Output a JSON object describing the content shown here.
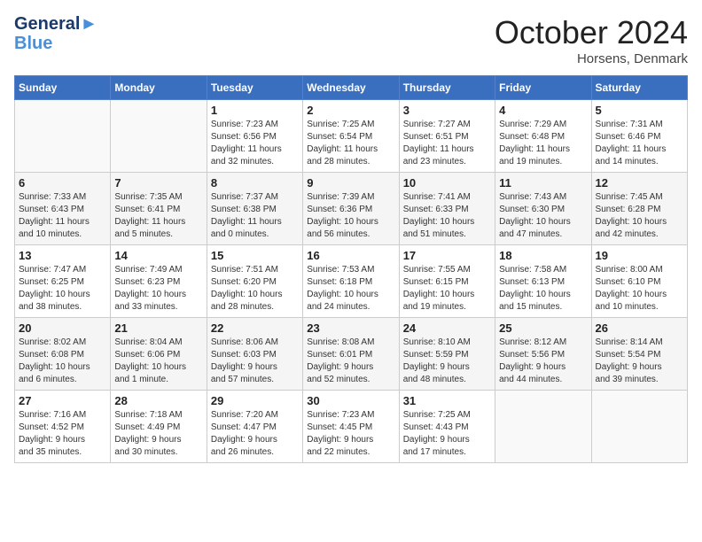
{
  "header": {
    "logo_line1": "General",
    "logo_line2": "Blue",
    "month": "October 2024",
    "location": "Horsens, Denmark"
  },
  "weekdays": [
    "Sunday",
    "Monday",
    "Tuesday",
    "Wednesday",
    "Thursday",
    "Friday",
    "Saturday"
  ],
  "weeks": [
    [
      {
        "day": "",
        "info": ""
      },
      {
        "day": "",
        "info": ""
      },
      {
        "day": "1",
        "info": "Sunrise: 7:23 AM\nSunset: 6:56 PM\nDaylight: 11 hours\nand 32 minutes."
      },
      {
        "day": "2",
        "info": "Sunrise: 7:25 AM\nSunset: 6:54 PM\nDaylight: 11 hours\nand 28 minutes."
      },
      {
        "day": "3",
        "info": "Sunrise: 7:27 AM\nSunset: 6:51 PM\nDaylight: 11 hours\nand 23 minutes."
      },
      {
        "day": "4",
        "info": "Sunrise: 7:29 AM\nSunset: 6:48 PM\nDaylight: 11 hours\nand 19 minutes."
      },
      {
        "day": "5",
        "info": "Sunrise: 7:31 AM\nSunset: 6:46 PM\nDaylight: 11 hours\nand 14 minutes."
      }
    ],
    [
      {
        "day": "6",
        "info": "Sunrise: 7:33 AM\nSunset: 6:43 PM\nDaylight: 11 hours\nand 10 minutes."
      },
      {
        "day": "7",
        "info": "Sunrise: 7:35 AM\nSunset: 6:41 PM\nDaylight: 11 hours\nand 5 minutes."
      },
      {
        "day": "8",
        "info": "Sunrise: 7:37 AM\nSunset: 6:38 PM\nDaylight: 11 hours\nand 0 minutes."
      },
      {
        "day": "9",
        "info": "Sunrise: 7:39 AM\nSunset: 6:36 PM\nDaylight: 10 hours\nand 56 minutes."
      },
      {
        "day": "10",
        "info": "Sunrise: 7:41 AM\nSunset: 6:33 PM\nDaylight: 10 hours\nand 51 minutes."
      },
      {
        "day": "11",
        "info": "Sunrise: 7:43 AM\nSunset: 6:30 PM\nDaylight: 10 hours\nand 47 minutes."
      },
      {
        "day": "12",
        "info": "Sunrise: 7:45 AM\nSunset: 6:28 PM\nDaylight: 10 hours\nand 42 minutes."
      }
    ],
    [
      {
        "day": "13",
        "info": "Sunrise: 7:47 AM\nSunset: 6:25 PM\nDaylight: 10 hours\nand 38 minutes."
      },
      {
        "day": "14",
        "info": "Sunrise: 7:49 AM\nSunset: 6:23 PM\nDaylight: 10 hours\nand 33 minutes."
      },
      {
        "day": "15",
        "info": "Sunrise: 7:51 AM\nSunset: 6:20 PM\nDaylight: 10 hours\nand 28 minutes."
      },
      {
        "day": "16",
        "info": "Sunrise: 7:53 AM\nSunset: 6:18 PM\nDaylight: 10 hours\nand 24 minutes."
      },
      {
        "day": "17",
        "info": "Sunrise: 7:55 AM\nSunset: 6:15 PM\nDaylight: 10 hours\nand 19 minutes."
      },
      {
        "day": "18",
        "info": "Sunrise: 7:58 AM\nSunset: 6:13 PM\nDaylight: 10 hours\nand 15 minutes."
      },
      {
        "day": "19",
        "info": "Sunrise: 8:00 AM\nSunset: 6:10 PM\nDaylight: 10 hours\nand 10 minutes."
      }
    ],
    [
      {
        "day": "20",
        "info": "Sunrise: 8:02 AM\nSunset: 6:08 PM\nDaylight: 10 hours\nand 6 minutes."
      },
      {
        "day": "21",
        "info": "Sunrise: 8:04 AM\nSunset: 6:06 PM\nDaylight: 10 hours\nand 1 minute."
      },
      {
        "day": "22",
        "info": "Sunrise: 8:06 AM\nSunset: 6:03 PM\nDaylight: 9 hours\nand 57 minutes."
      },
      {
        "day": "23",
        "info": "Sunrise: 8:08 AM\nSunset: 6:01 PM\nDaylight: 9 hours\nand 52 minutes."
      },
      {
        "day": "24",
        "info": "Sunrise: 8:10 AM\nSunset: 5:59 PM\nDaylight: 9 hours\nand 48 minutes."
      },
      {
        "day": "25",
        "info": "Sunrise: 8:12 AM\nSunset: 5:56 PM\nDaylight: 9 hours\nand 44 minutes."
      },
      {
        "day": "26",
        "info": "Sunrise: 8:14 AM\nSunset: 5:54 PM\nDaylight: 9 hours\nand 39 minutes."
      }
    ],
    [
      {
        "day": "27",
        "info": "Sunrise: 7:16 AM\nSunset: 4:52 PM\nDaylight: 9 hours\nand 35 minutes."
      },
      {
        "day": "28",
        "info": "Sunrise: 7:18 AM\nSunset: 4:49 PM\nDaylight: 9 hours\nand 30 minutes."
      },
      {
        "day": "29",
        "info": "Sunrise: 7:20 AM\nSunset: 4:47 PM\nDaylight: 9 hours\nand 26 minutes."
      },
      {
        "day": "30",
        "info": "Sunrise: 7:23 AM\nSunset: 4:45 PM\nDaylight: 9 hours\nand 22 minutes."
      },
      {
        "day": "31",
        "info": "Sunrise: 7:25 AM\nSunset: 4:43 PM\nDaylight: 9 hours\nand 17 minutes."
      },
      {
        "day": "",
        "info": ""
      },
      {
        "day": "",
        "info": ""
      }
    ]
  ]
}
